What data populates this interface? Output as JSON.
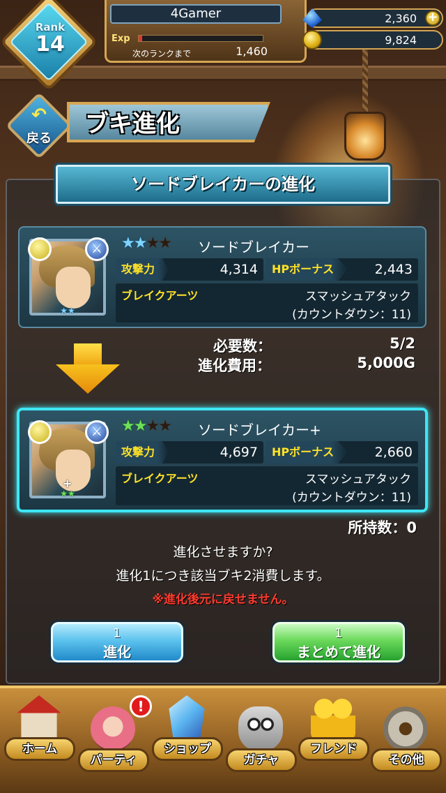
{
  "header": {
    "rank_label": "Rank",
    "rank_value": "14",
    "username": "4Gamer",
    "exp_label": "Exp",
    "exp_progress": 0.03,
    "next_rank_label": "次のランクまで",
    "next_rank_value": "1,460",
    "gems": "2,360",
    "coins": "9,824"
  },
  "nav": {
    "back_label": "戻る",
    "page_title": "ブキ進化"
  },
  "evolution": {
    "section_title": "ソードブレイカーの進化",
    "before": {
      "stars_on": 2,
      "stars_total": 4,
      "name": "ソードブレイカー",
      "atk_label": "攻撃力",
      "atk_value": "4,314",
      "hp_label": "HPボーナス",
      "hp_value": "2,443",
      "skill_label": "ブレイクアーツ",
      "skill_name": "スマッシュアタック",
      "skill_countdown": "(カウントダウン：11)"
    },
    "required_label": "必要数：",
    "required_value": "5/2",
    "cost_label": "進化費用：",
    "cost_value": "5,000G",
    "after": {
      "stars_on": 2,
      "stars_total": 4,
      "name": "ソードブレイカー+",
      "atk_label": "攻撃力",
      "atk_value": "4,697",
      "hp_label": "HPボーナス",
      "hp_value": "2,660",
      "skill_label": "ブレイクアーツ",
      "skill_name": "スマッシュアタック",
      "skill_countdown": "(カウントダウン：11)"
    },
    "owned_label": "所持数：0",
    "confirm_line1": "進化させますか?",
    "confirm_line2": "進化1につき該当ブキ2消費します。",
    "warning": "※進化後元に戻せません。",
    "btn_single_count": "1",
    "btn_single_label": "進化",
    "btn_bulk_count": "1",
    "btn_bulk_label": "まとめて進化"
  },
  "bottom_nav": {
    "home": "ホーム",
    "party": "パーティ",
    "shop": "ショップ",
    "gacha": "ガチャ",
    "friend": "フレンド",
    "other": "その他",
    "party_alert": "!"
  },
  "icons": {
    "gem": "blue-gem-icon",
    "coin": "gold-coin-icon",
    "add": "plus-icon",
    "back": "back-arrow-icon",
    "attribute": "light-attribute-icon",
    "weapon_type": "sword-type-icon"
  },
  "colors": {
    "accent_gold": "#d7a653",
    "highlight_cyan": "#3fe6f4",
    "stat_label": "#ffe227",
    "warning_red": "#ff3b2f",
    "button_blue": "#1a84c6",
    "button_green": "#1f9c2a"
  }
}
